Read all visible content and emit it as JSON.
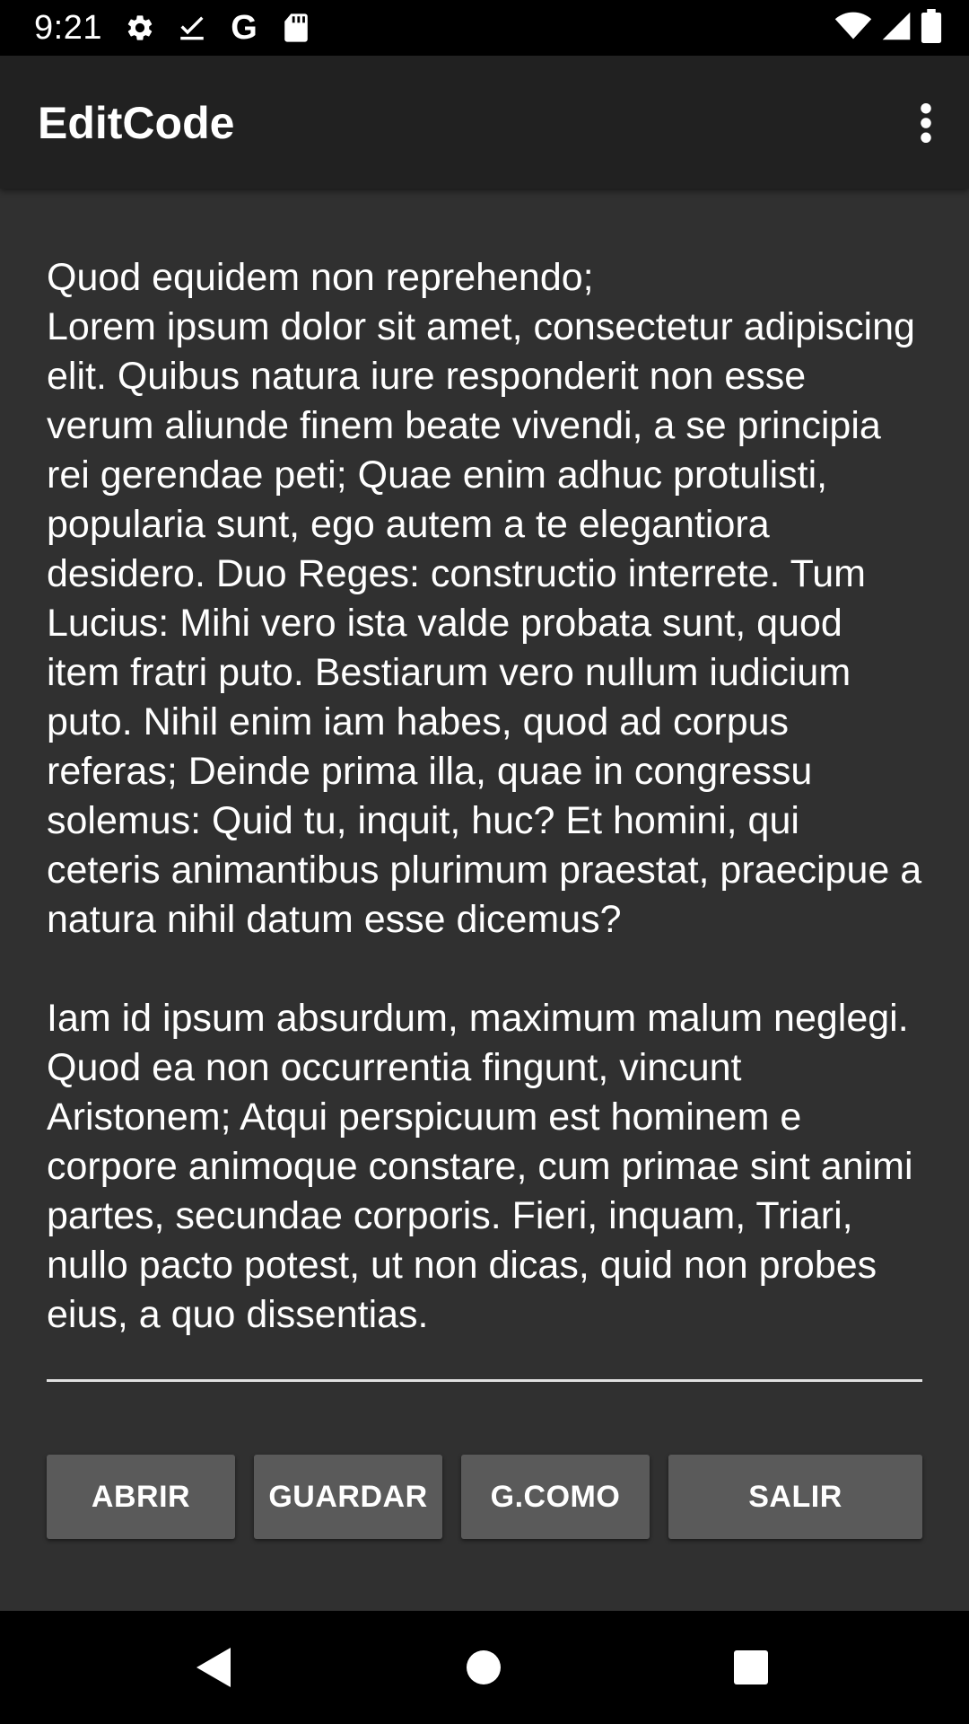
{
  "status_bar": {
    "time": "9:21",
    "icons_left": [
      "settings-icon",
      "checkbox-done-icon",
      "google-icon",
      "sd-card-icon"
    ],
    "g_letter": "G",
    "icons_right": [
      "wifi-icon",
      "signal-icon",
      "battery-icon"
    ]
  },
  "app_bar": {
    "title": "EditCode",
    "overflow_icon": "more-vert-icon"
  },
  "editor": {
    "text": "Quod equidem non reprehendo;\nLorem ipsum dolor sit amet, consectetur adipiscing elit. Quibus natura iure responderit non esse verum aliunde finem beate vivendi, a se principia rei gerendae peti; Quae enim adhuc protulisti, popularia sunt, ego autem a te elegantiora desidero. Duo Reges: constructio interrete. Tum Lucius: Mihi vero ista valde probata sunt, quod item fratri puto. Bestiarum vero nullum iudicium puto. Nihil enim iam habes, quod ad corpus referas; Deinde prima illa, quae in congressu solemus: Quid tu, inquit, huc? Et homini, qui ceteris animantibus plurimum praestat, praecipue a natura nihil datum esse dicemus?\n\nIam id ipsum absurdum, maximum malum neglegi. Quod ea non occurrentia fingunt, vincunt Aristonem; Atqui perspicuum est hominem e corpore animoque constare, cum primae sint animi partes, secundae corporis. Fieri, inquam, Triari, nullo pacto potest, ut non dicas, quid non probes eius, a quo dissentias."
  },
  "buttons": {
    "open": "ABRIR",
    "save": "GUARDAR",
    "save_as": "G.COMO",
    "exit": "SALIR"
  },
  "nav_bar": {
    "back_icon": "back-triangle-icon",
    "home_icon": "home-circle-icon",
    "recents_icon": "recents-square-icon"
  },
  "colors": {
    "background": "#303030",
    "app_bar": "#212121",
    "status_bar": "#000000",
    "button": "#5a5a5a",
    "text": "#ffffff"
  }
}
